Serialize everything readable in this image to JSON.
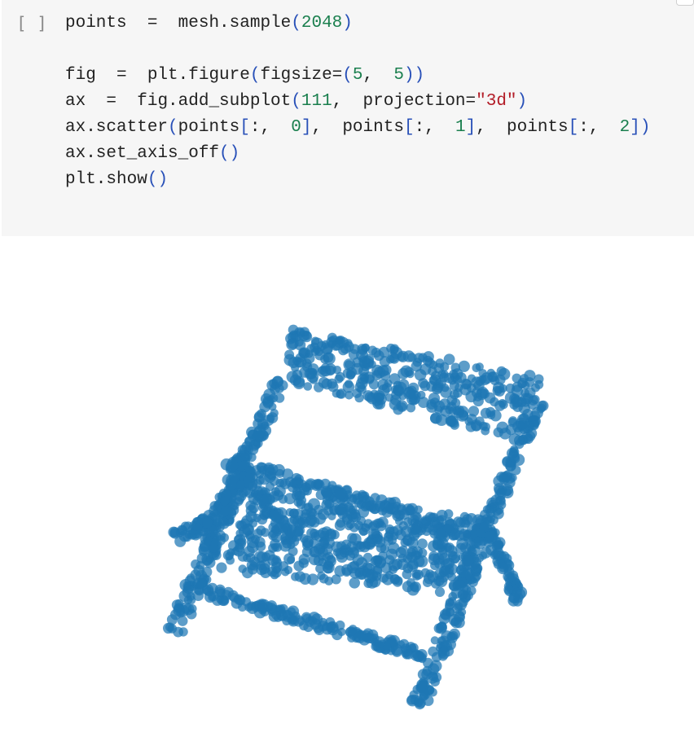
{
  "cell": {
    "prompt": "[ ]",
    "code_lines": [
      [
        [
          "t",
          "points"
        ],
        [
          "t",
          "  =  "
        ],
        [
          "t",
          "mesh.sample"
        ],
        [
          "p",
          "("
        ],
        [
          "n",
          "2048"
        ],
        [
          "p",
          ")"
        ]
      ],
      [],
      [
        [
          "t",
          "fig"
        ],
        [
          "t",
          "  =  "
        ],
        [
          "t",
          "plt.figure"
        ],
        [
          "p",
          "("
        ],
        [
          "t",
          "figsize="
        ],
        [
          "p",
          "("
        ],
        [
          "n",
          "5"
        ],
        [
          "t",
          ",  "
        ],
        [
          "n",
          "5"
        ],
        [
          "p",
          ")"
        ],
        [
          "p",
          ")"
        ]
      ],
      [
        [
          "t",
          "ax"
        ],
        [
          "t",
          "  =  "
        ],
        [
          "t",
          "fig.add_subplot"
        ],
        [
          "p",
          "("
        ],
        [
          "n",
          "111"
        ],
        [
          "t",
          ",  "
        ],
        [
          "t",
          "projection="
        ],
        [
          "s",
          "\"3d\""
        ],
        [
          "p",
          ")"
        ]
      ],
      [
        [
          "t",
          "ax.scatter"
        ],
        [
          "p",
          "("
        ],
        [
          "t",
          "points"
        ],
        [
          "p",
          "["
        ],
        [
          "t",
          ":,  "
        ],
        [
          "n",
          "0"
        ],
        [
          "p",
          "]"
        ],
        [
          "t",
          ",  "
        ],
        [
          "t",
          "points"
        ],
        [
          "p",
          "["
        ],
        [
          "t",
          ":,  "
        ],
        [
          "n",
          "1"
        ],
        [
          "p",
          "]"
        ],
        [
          "t",
          ",  "
        ],
        [
          "t",
          "points"
        ],
        [
          "p",
          "["
        ],
        [
          "t",
          ":,  "
        ],
        [
          "n",
          "2"
        ],
        [
          "p",
          "]"
        ],
        [
          "p",
          ")"
        ]
      ],
      [
        [
          "t",
          "ax.set_axis_off"
        ],
        [
          "p",
          "("
        ],
        [
          "p",
          ")"
        ]
      ],
      [
        [
          "t",
          "plt.show"
        ],
        [
          "p",
          "("
        ],
        [
          "p",
          ")"
        ]
      ]
    ]
  },
  "colors": {
    "point": "#1f77b4",
    "cell_bg": "#f6f6f6",
    "paren": "#2850b8",
    "number": "#1a7f4e",
    "string": "#b31d28"
  },
  "chart_data": {
    "type": "scatter",
    "title": "",
    "xlabel": "",
    "ylabel": "",
    "grid": false,
    "axes": "off",
    "n_points_sampled": 2048,
    "subject": "3D point cloud scatter of a folding chair",
    "series": [
      {
        "color": "#1f77b4",
        "segments": [
          {
            "part": "backrest-top",
            "from": [
              355,
              425
            ],
            "to": [
              660,
              485
            ],
            "width": 44,
            "count": 220
          },
          {
            "part": "backrest-bar",
            "from": [
              358,
              455
            ],
            "to": [
              640,
              528
            ],
            "width": 30,
            "count": 140
          },
          {
            "part": "back-post-left",
            "from": [
              345,
              470
            ],
            "to": [
              255,
              660
            ],
            "width": 18,
            "count": 110
          },
          {
            "part": "back-post-right",
            "from": [
              660,
              495
            ],
            "to": [
              600,
              640
            ],
            "width": 16,
            "count": 80
          },
          {
            "part": "front-leg-left",
            "from": [
              300,
              575
            ],
            "to": [
              215,
              775
            ],
            "width": 22,
            "count": 140
          },
          {
            "part": "front-leg-right",
            "from": [
              600,
              640
            ],
            "to": [
              515,
              865
            ],
            "width": 22,
            "count": 150
          },
          {
            "part": "seat-front-rail",
            "from": [
              250,
              725
            ],
            "to": [
              520,
              805
            ],
            "width": 14,
            "count": 150
          },
          {
            "part": "seat-back-rail",
            "from": [
              305,
              575
            ],
            "to": [
              610,
              660
            ],
            "width": 16,
            "count": 130
          },
          {
            "part": "cross-brace",
            "from": [
              285,
              565
            ],
            "to": [
              360,
              665
            ],
            "width": 20,
            "count": 80
          },
          {
            "part": "rear-leg-right",
            "from": [
              600,
              650
            ],
            "to": [
              638,
              740
            ],
            "width": 14,
            "count": 60
          },
          {
            "part": "left-knob",
            "from": [
              215,
              660
            ],
            "to": [
              260,
              640
            ],
            "width": 16,
            "count": 40
          }
        ],
        "blobs": [
          {
            "part": "seat-surface",
            "polygon": [
              [
                320,
                585
              ],
              [
                600,
                640
              ],
              [
                560,
                730
              ],
              [
                270,
                700
              ]
            ],
            "count": 500
          }
        ]
      }
    ]
  }
}
